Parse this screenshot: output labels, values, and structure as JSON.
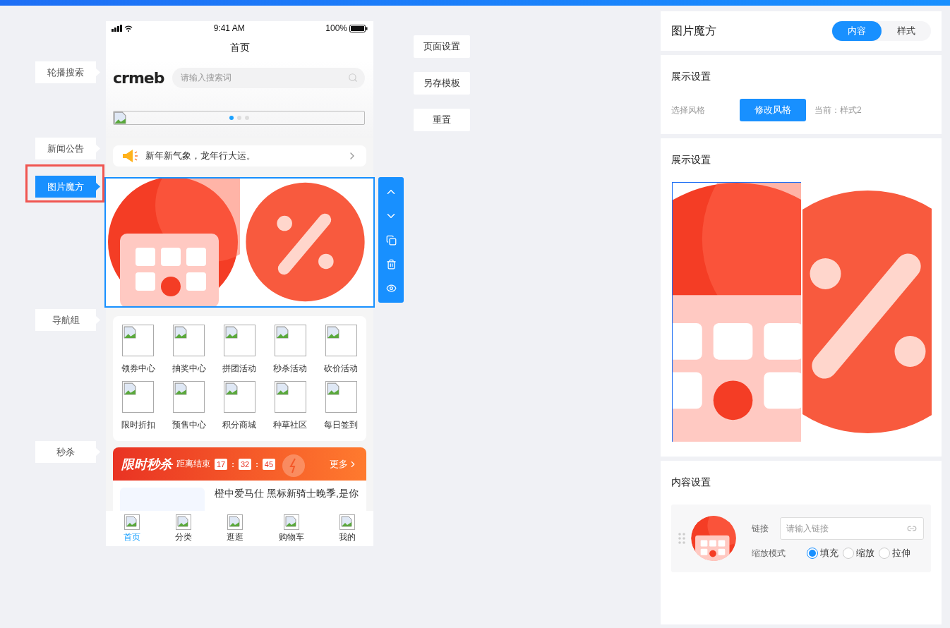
{
  "status_bar": {
    "time": "9:41 AM",
    "battery": "100%"
  },
  "page_title": "首页",
  "sections": [
    {
      "kind": "search",
      "label": "轮播搜索",
      "selected": false,
      "logo": "crmeb",
      "placeholder": "请输入搜索词",
      "banner_dots": [
        {
          "selected": true
        },
        {
          "selected": false
        },
        {
          "selected": false
        }
      ]
    },
    {
      "kind": "notice",
      "label": "新闻公告",
      "selected": false,
      "text": "新年新气象，龙年行大运。"
    },
    {
      "kind": "cube",
      "label": "图片魔方",
      "selected": true
    },
    {
      "kind": "nav",
      "label": "导航组",
      "selected": false,
      "items": [
        {
          "label": "领券中心"
        },
        {
          "label": "抽奖中心"
        },
        {
          "label": "拼团活动"
        },
        {
          "label": "秒杀活动"
        },
        {
          "label": "砍价活动"
        },
        {
          "label": "限时折扣"
        },
        {
          "label": "预售中心"
        },
        {
          "label": "积分商城"
        },
        {
          "label": "种草社区"
        },
        {
          "label": "每日签到"
        }
      ]
    },
    {
      "kind": "seckill",
      "label": "秒杀",
      "selected": false,
      "title": "限时秒杀",
      "countdown_label": "距离结束",
      "countdown": [
        {
          "kind": "digit",
          "text": "17"
        },
        {
          "kind": "sep",
          "text": ":"
        },
        {
          "kind": "digit",
          "text": "32"
        },
        {
          "kind": "sep",
          "text": ":"
        },
        {
          "kind": "digit",
          "text": "45"
        }
      ],
      "more": "更多",
      "product": "橙中爱马仕 黑标新骑士晚季,是你"
    }
  ],
  "tab_bar": [
    {
      "label": "首页",
      "selected": true
    },
    {
      "label": "分类",
      "selected": false
    },
    {
      "label": "逛逛",
      "selected": false
    },
    {
      "label": "购物车",
      "selected": false
    },
    {
      "label": "我的",
      "selected": false
    }
  ],
  "actions": [
    "页面设置",
    "另存模板",
    "重置"
  ],
  "editor": {
    "title": "图片魔方",
    "tabs": [
      {
        "label": "内容",
        "selected": true
      },
      {
        "label": "样式",
        "selected": false
      }
    ],
    "style_section": {
      "heading": "展示设置",
      "label": "选择风格",
      "button": "修改风格",
      "current": "当前：样式2"
    },
    "preview_section": {
      "heading": "展示设置",
      "cells": [
        {
          "selected": true
        },
        {
          "selected": false
        }
      ]
    },
    "content_section": {
      "heading": "内容设置",
      "items": [
        {
          "link_label": "链接",
          "link_placeholder": "请输入链接",
          "mode_label": "缩放模式",
          "modes": [
            {
              "label": "填充",
              "selected": true
            },
            {
              "label": "缩放",
              "selected": false
            },
            {
              "label": "拉伸",
              "selected": false
            }
          ]
        }
      ]
    }
  }
}
